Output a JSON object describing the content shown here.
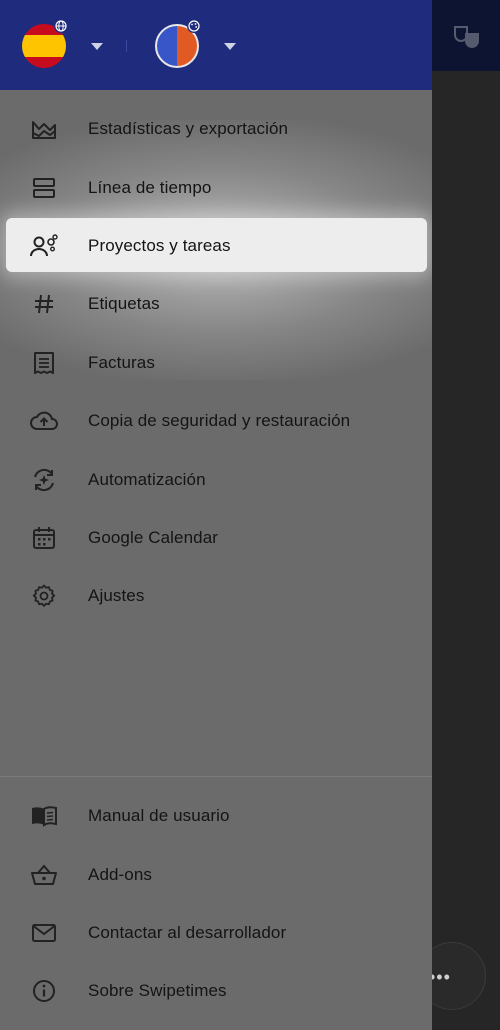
{
  "colors": {
    "header": "#1f2b7d",
    "drawer": "#6b6b6b",
    "active_item": "#ededed",
    "flag_red": "#c60b1e",
    "flag_yellow": "#ffc400",
    "theme_blue": "#3956c8",
    "theme_orange": "#e25a23"
  },
  "header": {
    "language_icon": "spain-flag-icon",
    "theme_icon": "theme-color-icon"
  },
  "menu": {
    "items": [
      {
        "label": "Estadísticas y exportación",
        "icon": "chart-icon"
      },
      {
        "label": "Línea de tiempo",
        "icon": "timeline-icon"
      },
      {
        "label": "Proyectos y tareas",
        "icon": "projects-icon",
        "active": true
      },
      {
        "label": "Etiquetas",
        "icon": "hashtag-icon"
      },
      {
        "label": "Facturas",
        "icon": "invoice-icon"
      },
      {
        "label": "Copia de seguridad y restauración",
        "icon": "cloud-upload-icon"
      },
      {
        "label": "Automatización",
        "icon": "automation-icon"
      },
      {
        "label": "Google Calendar",
        "icon": "calendar-icon"
      },
      {
        "label": "Ajustes",
        "icon": "gear-icon"
      }
    ],
    "bottom": [
      {
        "label": "Manual de usuario",
        "icon": "book-icon"
      },
      {
        "label": "Add-ons",
        "icon": "basket-icon"
      },
      {
        "label": "Contactar al desarrollador",
        "icon": "mail-icon"
      },
      {
        "label": "Sobre Swipetimes",
        "icon": "info-icon"
      }
    ]
  },
  "background": {
    "fab_label": "•••"
  }
}
